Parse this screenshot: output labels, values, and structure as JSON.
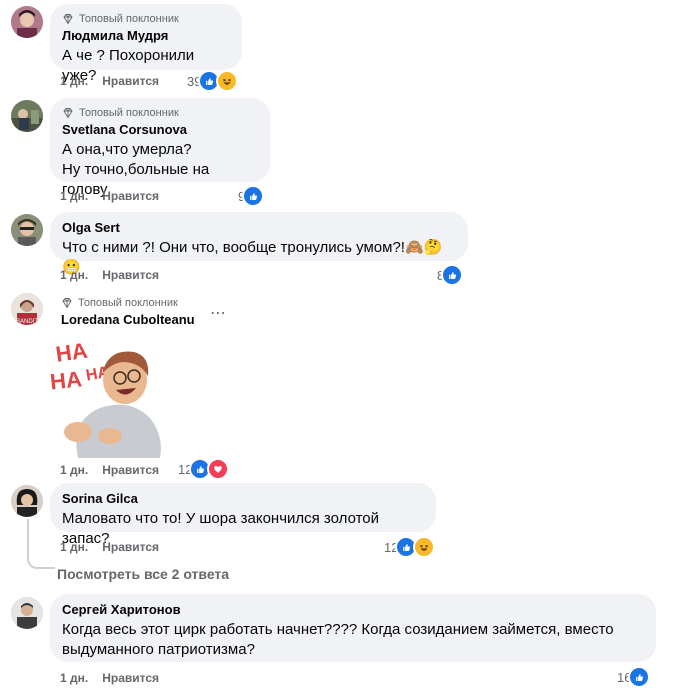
{
  "comments": [
    {
      "badge": "Топовый поклонник",
      "author": "Людмила Мудря",
      "text": "А че ? Похоронили уже?",
      "time": "1 дн.",
      "like_label": "Нравится",
      "reactions_count": "39",
      "reactions": [
        "like-icon",
        "haha-icon"
      ]
    },
    {
      "badge": "Топовый поклонник",
      "author": "Svetlana Corsunova",
      "text": "А она,что умерла?\nНу точно,больные на голову",
      "time": "1 дн.",
      "like_label": "Нравится",
      "reactions_count": "9",
      "reactions": [
        "like-icon"
      ]
    },
    {
      "author": "Olga Sert",
      "text": "Что с ними ?! Они что, вообще тронулись умом?!🙈🤔😬",
      "time": "1 дн.",
      "like_label": "Нравится",
      "reactions_count": "8",
      "reactions": [
        "like-icon"
      ]
    },
    {
      "badge": "Топовый поклонник",
      "author": "Loredana Cubolteanu",
      "sticker_text": "HA HA HA",
      "time": "1 дн.",
      "like_label": "Нравится",
      "reactions_count": "12",
      "reactions": [
        "like-icon",
        "love-icon"
      ]
    },
    {
      "author": "Sorina Gilca",
      "text": "Маловато что то! У шора закончился золотой запас?",
      "time": "1 дн.",
      "like_label": "Нравится",
      "reactions_count": "12",
      "reactions": [
        "like-icon",
        "haha-icon"
      ]
    },
    {
      "author": "Сергей Харитонов",
      "text": "Когда весь этот цирк работать начнет???? Когда созиданием займется, вместо\nвыдуманного патриотизма?",
      "time": "1 дн.",
      "like_label": "Нравится",
      "reactions_count": "16",
      "reactions": [
        "like-icon"
      ]
    }
  ],
  "view_replies": "Посмотреть все 2 ответа",
  "colors": {
    "like": "#1b74e4",
    "love": "#f33e58",
    "haha": "#f7b928",
    "bubble": "#f0f2f5",
    "meta": "#65676b"
  }
}
